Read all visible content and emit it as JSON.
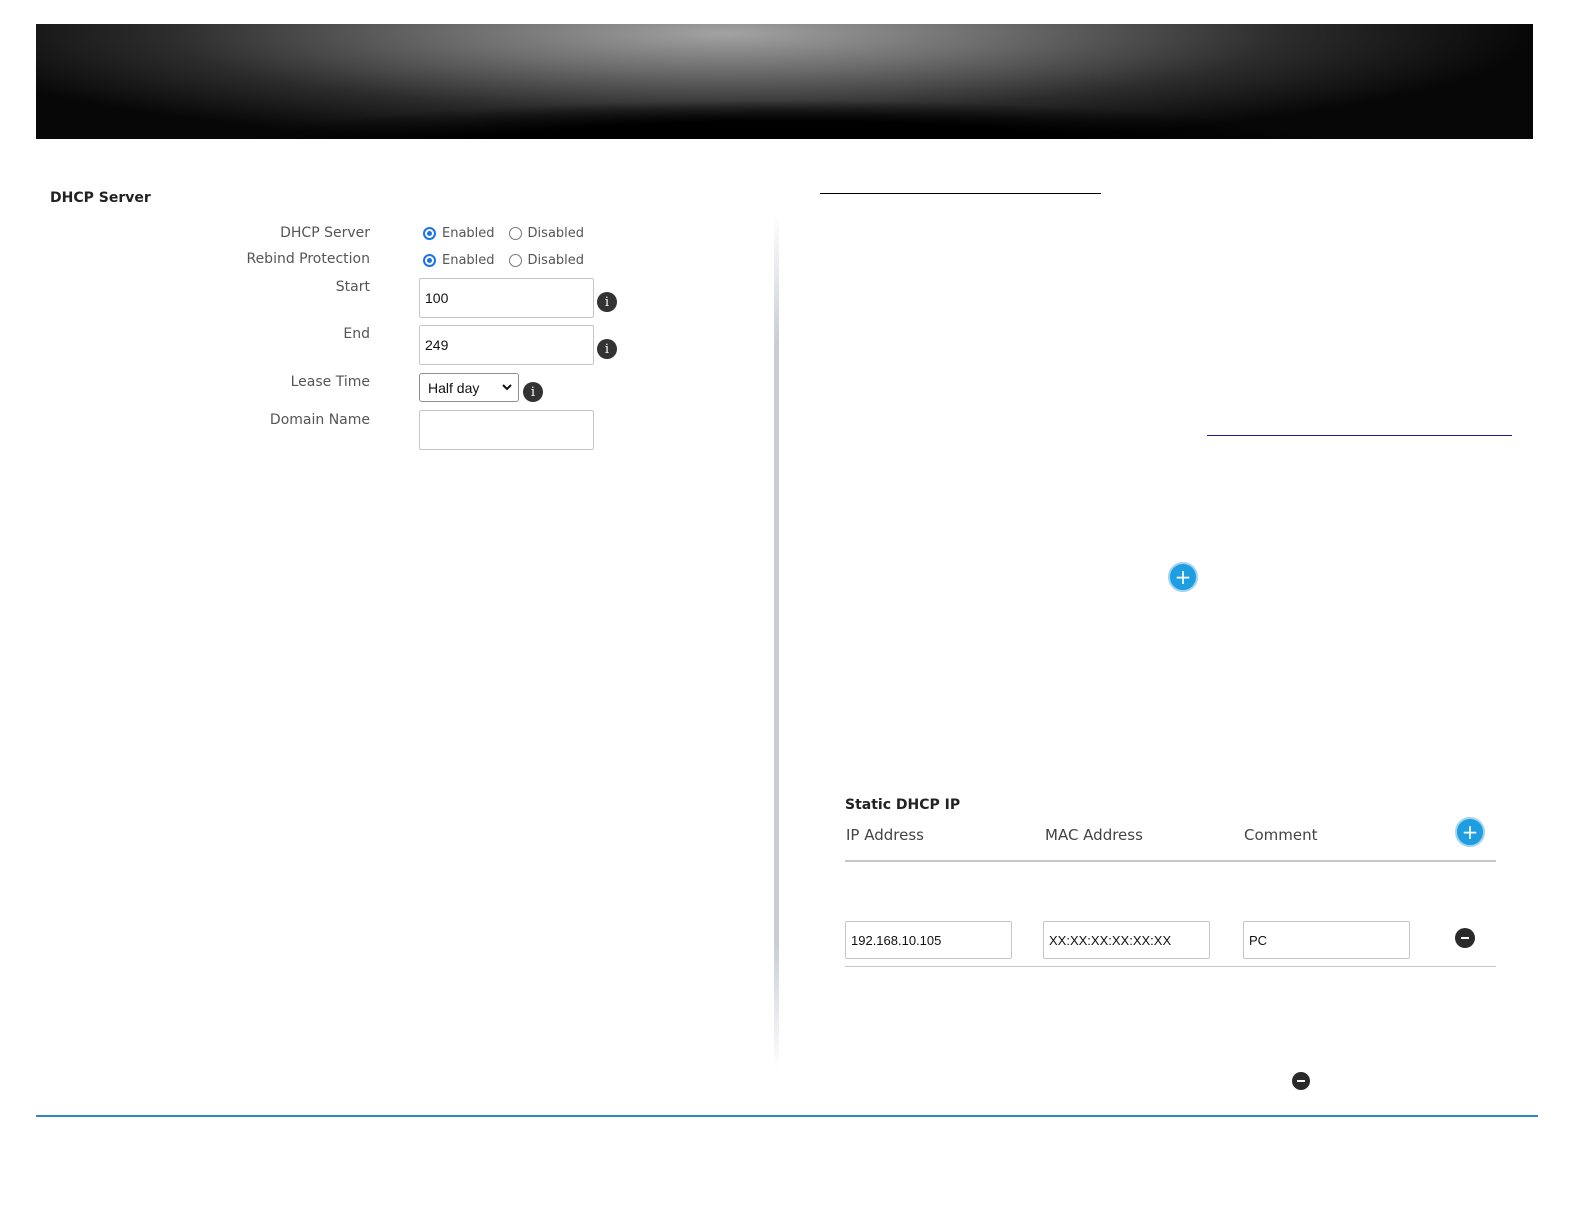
{
  "dhcp_panel": {
    "title": "DHCP Server",
    "dhcp_server": {
      "label": "DHCP Server",
      "option_enabled": "Enabled",
      "option_disabled": "Disabled",
      "selected": "Enabled"
    },
    "rebind_protection": {
      "label": "Rebind Protection",
      "option_enabled": "Enabled",
      "option_disabled": "Disabled",
      "selected": "Enabled"
    },
    "start": {
      "label": "Start",
      "value": "100"
    },
    "end": {
      "label": "End",
      "value": "249"
    },
    "lease_time": {
      "label": "Lease Time",
      "selected": "Half day"
    },
    "domain_name": {
      "label": "Domain Name",
      "value": ""
    },
    "info_glyph": "i"
  },
  "static_dhcp": {
    "title": "Static DHCP IP",
    "columns": {
      "ip": "IP Address",
      "mac": "MAC Address",
      "comment": "Comment"
    },
    "rows": [
      {
        "ip": "192.168.10.105",
        "mac": "XX:XX:XX:XX:XX:XX",
        "comment": "PC"
      }
    ],
    "add_glyph": "+"
  },
  "colors": {
    "accent_blue": "#1e9ee0",
    "radio_blue": "#1a73e8",
    "footer_line": "#2e86c1"
  }
}
